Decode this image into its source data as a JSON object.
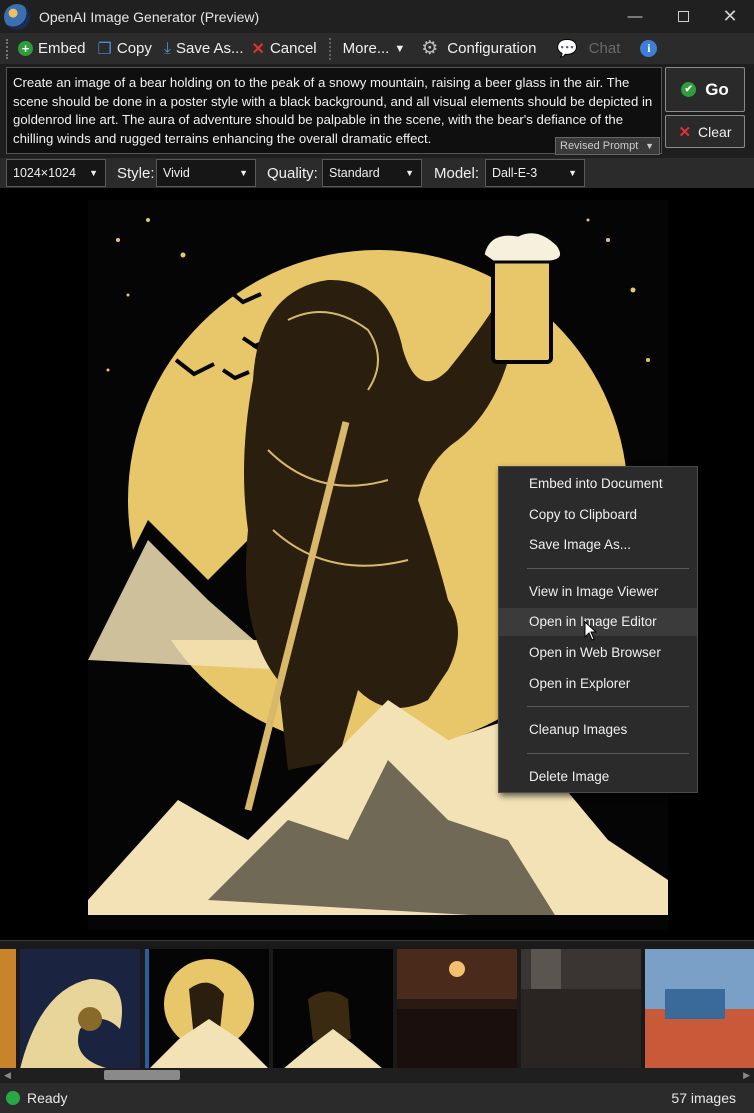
{
  "window": {
    "title": "OpenAI Image Generator (Preview)"
  },
  "toolbar": {
    "embed": "Embed",
    "copy": "Copy",
    "save_as": "Save As...",
    "cancel": "Cancel",
    "more": "More...",
    "configuration": "Configuration",
    "chat": "Chat"
  },
  "prompt": {
    "text": "Create an image of a bear holding on to the peak of a snowy mountain, raising a beer glass in the air. The scene should be done in a poster style with a black background, and all visual elements should be depicted in goldenrod line art. The aura of adventure should be palpable in the scene, with the bear's defiance of the chilling winds and rugged terrains enhancing the overall dramatic effect.",
    "revised_label": "Revised Prompt"
  },
  "actions": {
    "go": "Go",
    "clear": "Clear"
  },
  "options": {
    "size_value": "1024×1024",
    "style_label": "Style:",
    "style_value": "Vivid",
    "quality_label": "Quality:",
    "quality_value": "Standard",
    "model_label": "Model:",
    "model_value": "Dall-E-3"
  },
  "context_menu": {
    "items": [
      "Embed into Document",
      "Copy to Clipboard",
      "Save Image As...",
      "View in Image Viewer",
      "Open in Image Editor",
      "Open in Web Browser",
      "Open in Explorer",
      "Cleanup Images",
      "Delete Image"
    ],
    "hovered": "Open in Image Editor"
  },
  "status": {
    "text": "Ready",
    "count": "57 images",
    "color": "#2aa745"
  },
  "colors": {
    "accent_gold": "#e8c66a",
    "background": "#1e1e1e"
  },
  "icons": [
    "app-icon",
    "embed-icon",
    "copy-icon",
    "save-icon",
    "cancel-icon",
    "chevron-down-icon",
    "gear-icon",
    "chat-icon",
    "info-icon",
    "check-icon",
    "close-icon"
  ]
}
